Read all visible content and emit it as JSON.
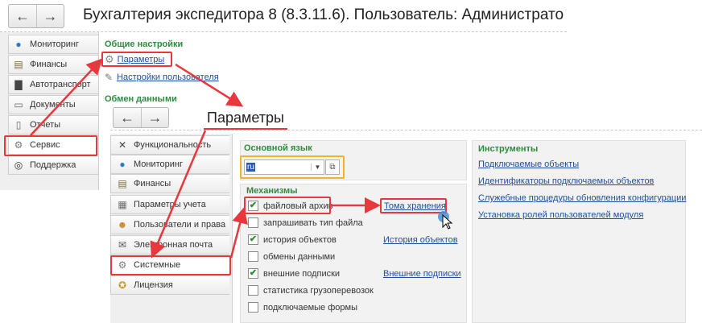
{
  "window_title": "Бухгалтерия экспедитора 8 (8.3.11.6). Пользователь: Администрато",
  "nav": {
    "back": "←",
    "forward": "→"
  },
  "sidebar": {
    "items": [
      {
        "label": "Мониторинг",
        "icon": "globe-icon",
        "glyph": "🌐"
      },
      {
        "label": "Финансы",
        "icon": "coins-icon",
        "glyph": "▤"
      },
      {
        "label": "Автотранспорт",
        "icon": "truck-icon",
        "glyph": "▇"
      },
      {
        "label": "Документы",
        "icon": "document-icon",
        "glyph": "▭"
      },
      {
        "label": "Отчеты",
        "icon": "report-icon",
        "glyph": "▯"
      },
      {
        "label": "Сервис",
        "icon": "gear-icon",
        "glyph": "⚙"
      },
      {
        "label": "Поддержка",
        "icon": "headset-icon",
        "glyph": "◎"
      }
    ]
  },
  "main": {
    "group_general": "Общие настройки",
    "link_params": "Параметры",
    "link_user_settings": "Настройки пользователя",
    "group_exchange": "Обмен данными"
  },
  "callout": "Параметры",
  "settings_nav": {
    "items": [
      {
        "label": "Функциональность",
        "icon": "tools-icon",
        "glyph": "✕"
      },
      {
        "label": "Мониторинг",
        "icon": "globe-icon",
        "glyph": "🌐"
      },
      {
        "label": "Финансы",
        "icon": "coins-icon",
        "glyph": "▤"
      },
      {
        "label": "Параметры учета",
        "icon": "ledger-icon",
        "glyph": "▦"
      },
      {
        "label": "Пользователи и права",
        "icon": "users-icon",
        "glyph": "☻"
      },
      {
        "label": "Электронная почта",
        "icon": "mail-icon",
        "glyph": "✉"
      },
      {
        "label": "Системные",
        "icon": "gear-icon",
        "glyph": "⚙"
      },
      {
        "label": "Лицензия",
        "icon": "medal-icon",
        "glyph": "✪"
      }
    ]
  },
  "language": {
    "title": "Основной язык",
    "value": "ru"
  },
  "mechanisms": {
    "title": "Механизмы",
    "items": [
      {
        "label": "файловый архив",
        "checked": true,
        "link": "Тома хранения"
      },
      {
        "label": "запрашивать тип файла",
        "checked": false,
        "link": ""
      },
      {
        "label": "история объектов",
        "checked": true,
        "link": "История объектов"
      },
      {
        "label": "обмены данными",
        "checked": false,
        "link": ""
      },
      {
        "label": "внешние подписки",
        "checked": true,
        "link": "Внешние подписки"
      },
      {
        "label": "статистика грузоперевозок",
        "checked": false,
        "link": ""
      },
      {
        "label": "подключаемые формы",
        "checked": false,
        "link": ""
      }
    ]
  },
  "tools": {
    "title": "Инструменты",
    "links": [
      "Подключаемые объекты",
      "Идентификаторы подключаемых объектов",
      "Служебные процедуры обновления конфигурации",
      "Установка ролей пользователей модуля"
    ]
  },
  "colors": {
    "accent_red": "#e8383d",
    "group_green": "#2e8b3e",
    "link_blue": "#1f4e9c",
    "lang_border": "#f0b429"
  }
}
